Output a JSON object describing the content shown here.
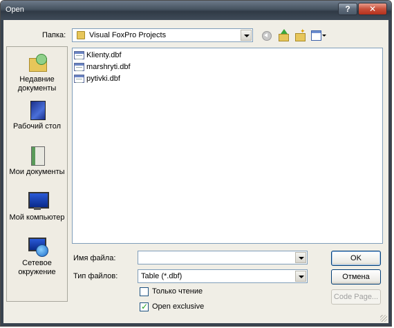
{
  "window": {
    "title": "Open",
    "help_label": "?",
    "close_label": "✕"
  },
  "look_in": {
    "label": "Папка:",
    "value": "Visual FoxPro Projects"
  },
  "places": [
    {
      "label": "Недавние документы",
      "icon": "recent-documents-icon"
    },
    {
      "label": "Рабочий стол",
      "icon": "desktop-icon"
    },
    {
      "label": "Мои документы",
      "icon": "my-documents-icon"
    },
    {
      "label": "Мой компьютер",
      "icon": "my-computer-icon"
    },
    {
      "label": "Сетевое окружение",
      "icon": "network-icon"
    }
  ],
  "files": [
    {
      "name": "Klienty.dbf"
    },
    {
      "name": "marshryti.dbf"
    },
    {
      "name": "pytivki.dbf"
    }
  ],
  "filename": {
    "label": "Имя файла:",
    "value": ""
  },
  "filetype": {
    "label": "Тип файлов:",
    "value": "Table (*.dbf)"
  },
  "checkboxes": {
    "readonly": {
      "label": "Только чтение",
      "checked": false
    },
    "exclusive": {
      "label": "Open exclusive",
      "checked": true
    }
  },
  "buttons": {
    "ok": "OK",
    "cancel": "Отмена",
    "codepage": "Code Page..."
  }
}
